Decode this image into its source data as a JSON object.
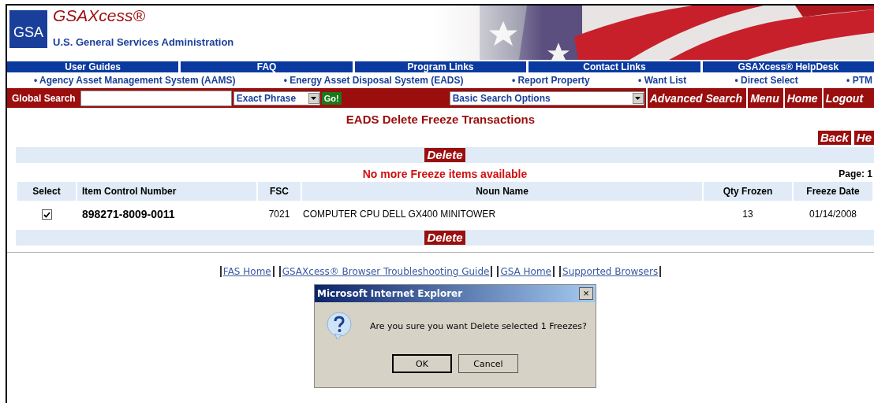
{
  "header": {
    "logo": "GSA",
    "product": "GSAXcess®",
    "agency": "U.S. General Services Administration"
  },
  "nav": [
    "User Guides",
    "FAQ",
    "Program Links",
    "Contact Links",
    "GSAXcess® HelpDesk"
  ],
  "links": [
    "• Agency Asset Management System (AAMS)",
    "• Energy Asset Disposal System (EADS)",
    "• Report Property",
    "• Want List",
    "• Direct Select",
    "• PTM"
  ],
  "search": {
    "label": "Global Search",
    "mode": "Exact Phrase",
    "go": "Go!",
    "options": "Basic Search Options",
    "buttons": [
      "Advanced Search",
      "Menu",
      "Home",
      "Logout"
    ]
  },
  "title": "EADS Delete Freeze Transactions",
  "actions": [
    "Back",
    "He"
  ],
  "delete_labels": [
    "Delete",
    "Delete"
  ],
  "message": "No more Freeze items available",
  "page": "Page: 1",
  "table": {
    "columns": [
      "Select",
      "Item Control Number",
      "FSC",
      "Noun Name",
      "Qty Frozen",
      "Freeze Date"
    ],
    "rows": [
      {
        "checked": true,
        "icn": "898271-8009-0011",
        "fsc": "7021",
        "noun": "COMPUTER CPU DELL GX400 MINITOWER",
        "qty": "13",
        "date": "01/14/2008"
      }
    ]
  },
  "footer_links": [
    "FAS Home",
    "GSAXcess® Browser Troubleshooting Guide",
    "GSA Home",
    "Supported Browsers"
  ],
  "dialog": {
    "title": "Microsoft Internet Explorer",
    "close": "×",
    "message": "Are you sure you want Delete selected 1 Freezes?",
    "buttons": [
      "OK",
      "Cancel"
    ]
  }
}
